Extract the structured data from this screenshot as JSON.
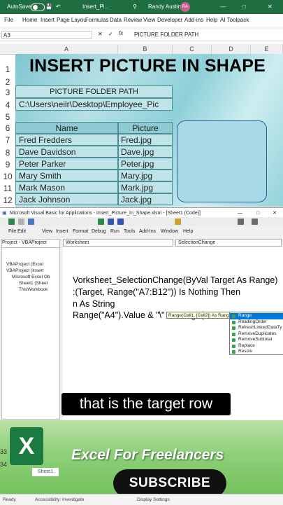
{
  "excel": {
    "autosave_label": "AutoSave",
    "autosave_state": "On",
    "file_name": "Insert_Pi...",
    "user_name": "Randy Austin",
    "user_initials": "RA",
    "tabs": [
      "File",
      "Home",
      "Insert",
      "Page Layou",
      "Formulas",
      "Data",
      "Review",
      "View",
      "Developer",
      "Add-ins",
      "Help",
      "AI Toolpack"
    ],
    "name_box": "A3",
    "formula": "PICTURE FOLDER PATH",
    "columns": [
      "A",
      "B",
      "C",
      "D",
      "E"
    ],
    "rows": [
      "1",
      "2",
      "3",
      "4",
      "5",
      "6",
      "7",
      "8",
      "9",
      "10",
      "11",
      "12"
    ],
    "sheet_title": "INSERT PICTURE IN SHAPE",
    "folder_label": "PICTURE FOLDER PATH",
    "folder_path": "C:\\Users\\neilr\\Desktop\\Employee_Pic",
    "table_headers": [
      "Name",
      "Picture"
    ],
    "table_rows": [
      [
        "Fred Fredders",
        "Fred.jpg"
      ],
      [
        "Dave Davidson",
        "Dave.jpg"
      ],
      [
        "Peter Parker",
        "Peter.jpg"
      ],
      [
        "Mary Smith",
        "Mary.jpg"
      ],
      [
        "Mark Mason",
        "Mark.jpg"
      ],
      [
        "Jack Johnson",
        "Jack.jpg"
      ]
    ]
  },
  "vba": {
    "title": "Microsoft Visual Basic for Applications - Insert_Picture_In_Shape.xlsm - [Sheet1 (Code)]",
    "menu": [
      "File",
      "Edit",
      "View",
      "Insert",
      "Format",
      "Debug",
      "Run",
      "Tools",
      "Add-Ins",
      "Window",
      "Help"
    ],
    "project_title": "Project - VBAProject",
    "tree": [
      "VBAProject (Excel",
      "VBAProject (Insert",
      "Microsoft Excel Ob",
      "Sheet1 (Sheet",
      "ThisWorkbook"
    ],
    "object_combo": "Worksheet",
    "proc_combo": "SelectionChange",
    "code_lines": [
      "Vorksheet_SelectionChange(ByVal Target As Range)",
      ":(Target, Range(\"A7:B12\")) Is Nothing Then",
      "n As String",
      "Range(\"A4\").Value & \"\\\" & Range(\"B\" & Target.R"
    ],
    "param_tip": "Range(Cell1, [Cell2]) As Range",
    "intellisense": [
      "Range",
      "ReadingOrder",
      "RefreshLinkedDataTy",
      "RemoveDuplicates",
      "RemoveSubtotal",
      "Replace",
      "Resize"
    ]
  },
  "caption": "that is the target row",
  "promo": {
    "logo_letter": "X",
    "tagline": "Excel For Freelancers",
    "subscribe": "SUBSCRIBE",
    "sheet_tab": "Sheet1",
    "rows": [
      "33",
      "34"
    ]
  },
  "status": {
    "ready": "Ready",
    "accessibility": "Accessibility: Investigate",
    "display": "Display Settings"
  },
  "colors": {
    "excel_green": "#1e6e41",
    "sheet_teal": "#8ed0d8",
    "select_blue": "#0078d7"
  }
}
